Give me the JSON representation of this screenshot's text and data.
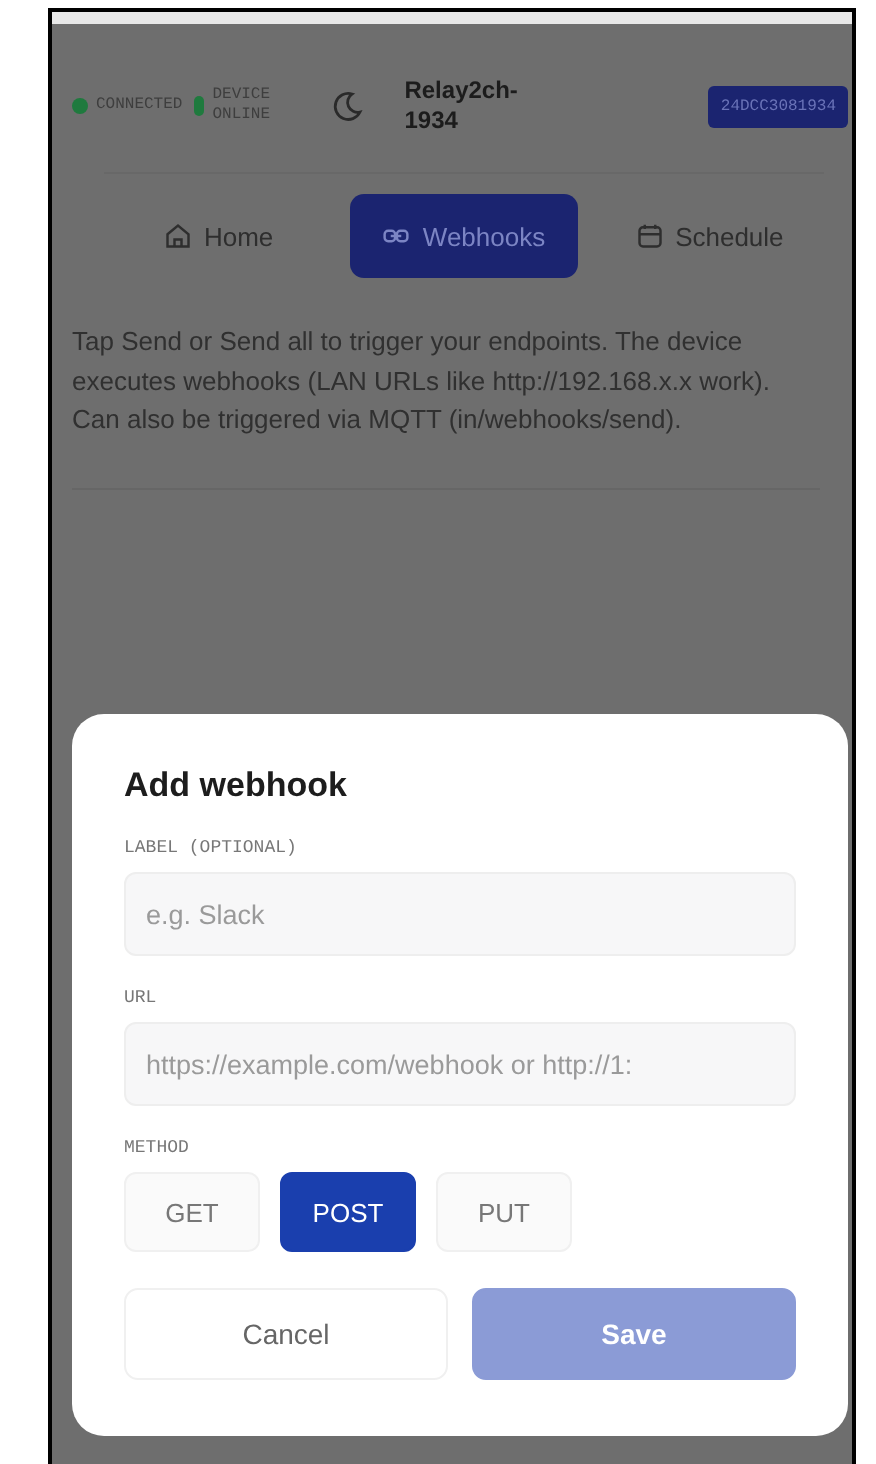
{
  "header": {
    "statuses": [
      {
        "label": "CONNECTED",
        "color": "#1f7a3e"
      },
      {
        "label": "DEVICE ONLINE",
        "color": "#1f7a3e"
      }
    ],
    "device_name": "Relay2ch-1934",
    "device_id": "24DCC3081934"
  },
  "tabs": [
    {
      "label": "Home",
      "kind": "home",
      "selected": false
    },
    {
      "label": "Webhooks",
      "kind": "webhooks",
      "selected": true
    },
    {
      "label": "Schedule",
      "kind": "schedule",
      "selected": false
    }
  ],
  "description": "Tap Send or Send all to trigger your endpoints. The device executes webhooks (LAN URLs like http://192.168.x.x work). Can also be triggered via MQTT (in/webhooks/send).",
  "dialog": {
    "title": "Add webhook",
    "fields": [
      {
        "label": "LABEL (OPTIONAL)",
        "placeholder": "e.g. Slack"
      },
      {
        "label": "URL",
        "placeholder": "https://example.com/webhook or http://1:"
      }
    ],
    "method_label": "METHOD",
    "methods": [
      {
        "label": "GET",
        "selected": false
      },
      {
        "label": "POST",
        "selected": true
      },
      {
        "label": "PUT",
        "selected": false
      }
    ],
    "buttons": [
      {
        "label": "Cancel",
        "kind": "secondary",
        "disabled": false
      },
      {
        "label": "Save",
        "kind": "primary",
        "disabled": true
      }
    ]
  }
}
